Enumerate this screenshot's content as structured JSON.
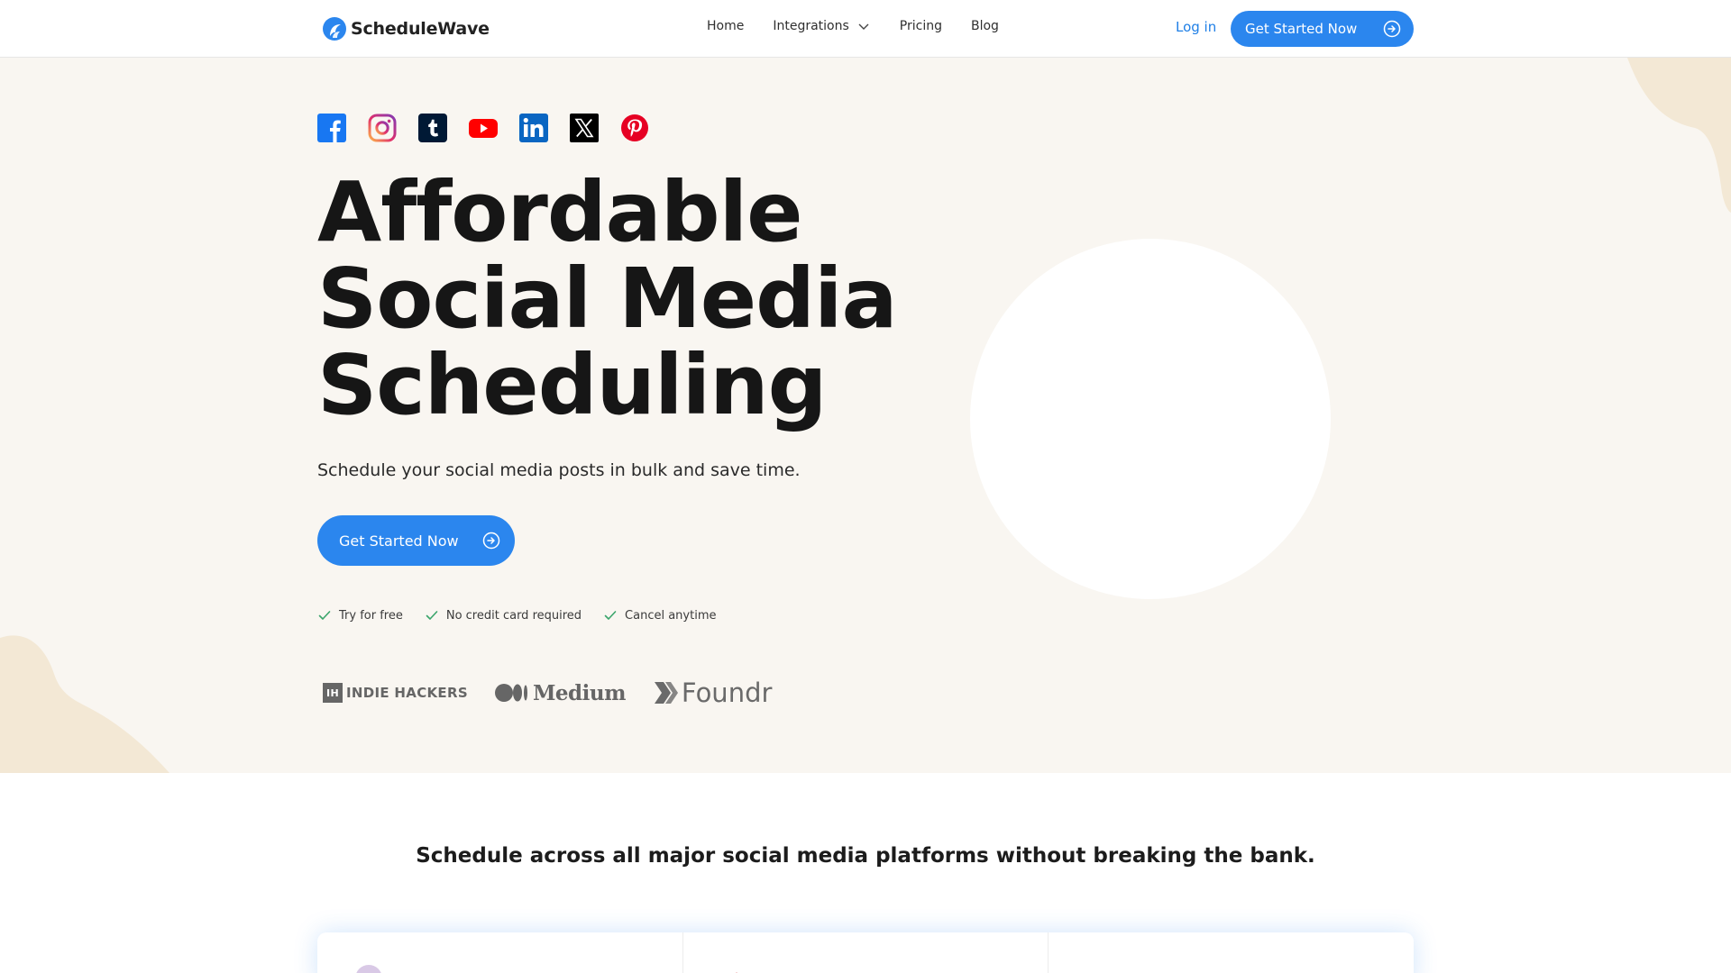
{
  "brand": {
    "name": "ScheduleWave",
    "logo_icon": "wave-logo-icon",
    "accent": "#2b86ee"
  },
  "nav": {
    "items": [
      {
        "label": "Home"
      },
      {
        "label": "Integrations",
        "has_dropdown": true
      },
      {
        "label": "Pricing"
      },
      {
        "label": "Blog"
      }
    ],
    "login_label": "Log in",
    "cta_label": "Get Started Now"
  },
  "hero": {
    "social_icons": [
      "facebook-icon",
      "instagram-icon",
      "tumblr-icon",
      "youtube-icon",
      "linkedin-icon",
      "x-icon",
      "pinterest-icon"
    ],
    "title_lines": [
      "Affordable",
      "Social Media",
      "Scheduling"
    ],
    "subtitle": "Schedule your social media posts in bulk and save time.",
    "cta_label": "Get Started Now",
    "perks": [
      "Try for free",
      "No credit card required",
      "Cancel anytime"
    ],
    "press": {
      "indie_hackers_mark": "IH",
      "indie_hackers": "INDIE HACKERS",
      "medium": "Medium",
      "foundr": "Foundr"
    },
    "background": "#f9f6f1"
  },
  "section": {
    "tagline": "Schedule across all major social media platforms without breaking the bank."
  }
}
